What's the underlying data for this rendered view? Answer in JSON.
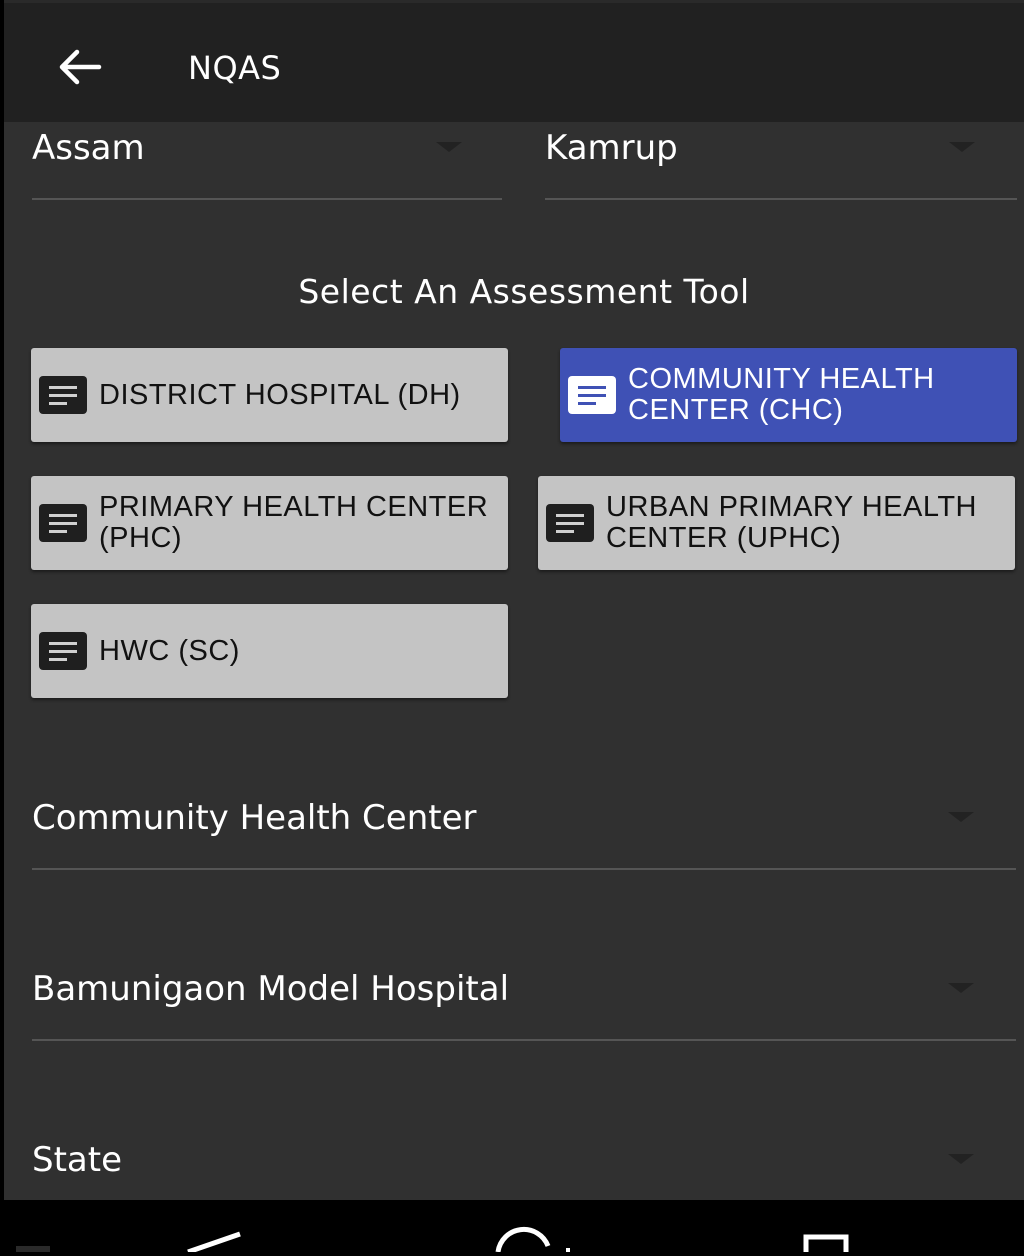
{
  "appbar": {
    "title": "NQAS"
  },
  "spinners": {
    "state": "Assam",
    "district": "Kamrup",
    "facility_type": "Community Health Center",
    "facility": "Bamunigaon Model Hospital",
    "state_placeholder": "State"
  },
  "section": {
    "title": "Select An Assessment Tool"
  },
  "tools": [
    {
      "label": "DISTRICT HOSPITAL (DH)",
      "selected": false
    },
    {
      "label": "COMMUNITY HEALTH\nCENTER (CHC)",
      "selected": true
    },
    {
      "label": "PRIMARY HEALTH CENTER\n(PHC)",
      "selected": false
    },
    {
      "label": "URBAN PRIMARY HEALTH\nCENTER (UPHC)",
      "selected": false
    },
    {
      "label": "HWC (SC)",
      "selected": false
    }
  ],
  "colors": {
    "accent": "#3f51b5",
    "background": "#303030",
    "appbar": "#212121"
  },
  "icons": {
    "back": "arrow-back-icon",
    "tool": "document-list-icon",
    "dropdown": "caret-down-icon"
  }
}
